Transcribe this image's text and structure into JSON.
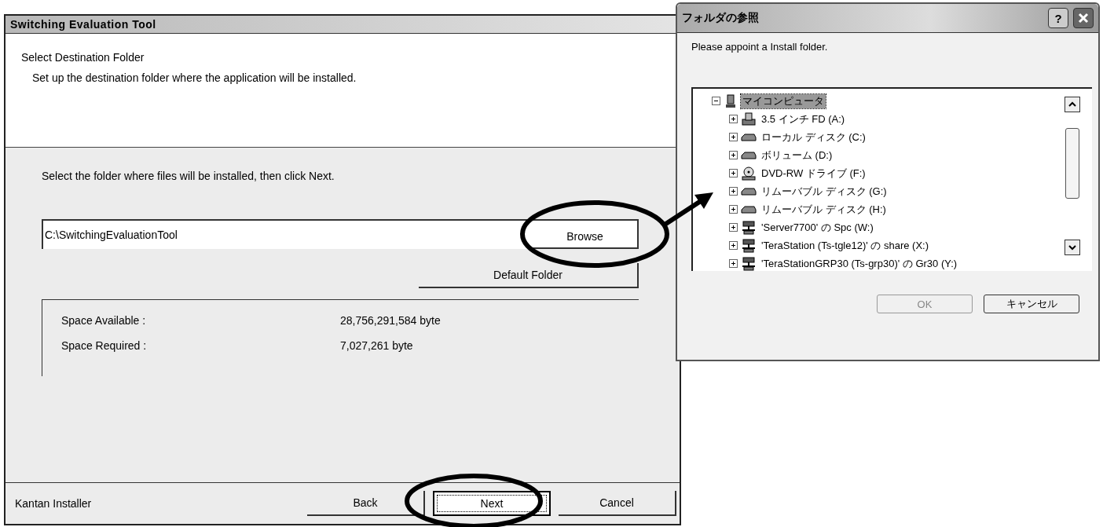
{
  "installer": {
    "title": "Switching Evaluation Tool",
    "header": {
      "heading": "Select Destination Folder",
      "subheading": "Set up the destination folder where the application will be installed."
    },
    "instruction": "Select the folder where files will be installed, then click Next.",
    "path_field": {
      "value": "C:\\SwitchingEvaluationTool"
    },
    "browse_button": "Browse",
    "default_folder_button": "Default Folder",
    "space": [
      {
        "label": "Space Available :",
        "value": "28,756,291,584 byte"
      },
      {
        "label": "Space Required :",
        "value": "7,027,261 byte"
      }
    ],
    "footer_label": "Kantan Installer",
    "buttons": [
      {
        "label": "Back",
        "focused": false
      },
      {
        "label": "Next",
        "focused": true
      },
      {
        "label": "Cancel",
        "focused": false
      }
    ]
  },
  "folder_dialog": {
    "title": "フォルダの参照",
    "help_button": "?",
    "message": "Please appoint a Install folder.",
    "tree": [
      {
        "label": "マイコンピュータ",
        "kind": "computer",
        "expanded": true,
        "selected": true,
        "children": [
          {
            "label": "3.5 インチ FD (A:)",
            "kind": "floppy",
            "expanded": false,
            "selected": false
          },
          {
            "label": "ローカル ディスク (C:)",
            "kind": "disk",
            "expanded": false,
            "selected": false
          },
          {
            "label": "ボリューム (D:)",
            "kind": "disk",
            "expanded": false,
            "selected": false
          },
          {
            "label": "DVD-RW ドライブ (F:)",
            "kind": "dvd",
            "expanded": false,
            "selected": false
          },
          {
            "label": "リムーバブル ディスク (G:)",
            "kind": "disk",
            "expanded": false,
            "selected": false
          },
          {
            "label": "リムーバブル ディスク (H:)",
            "kind": "disk",
            "expanded": false,
            "selected": false
          },
          {
            "label": "'Server7700' の Spc (W:)",
            "kind": "network",
            "expanded": false,
            "selected": false
          },
          {
            "label": "'TeraStation (Ts-tgle12)' の share (X:)",
            "kind": "network",
            "expanded": false,
            "selected": false
          },
          {
            "label": "'TeraStationGRP30 (Ts-grp30)' の Gr30 (Y:)",
            "kind": "network",
            "expanded": false,
            "selected": false
          }
        ]
      }
    ],
    "buttons": [
      {
        "label": "OK",
        "disabled": true
      },
      {
        "label": "キャンセル",
        "disabled": false
      }
    ]
  }
}
